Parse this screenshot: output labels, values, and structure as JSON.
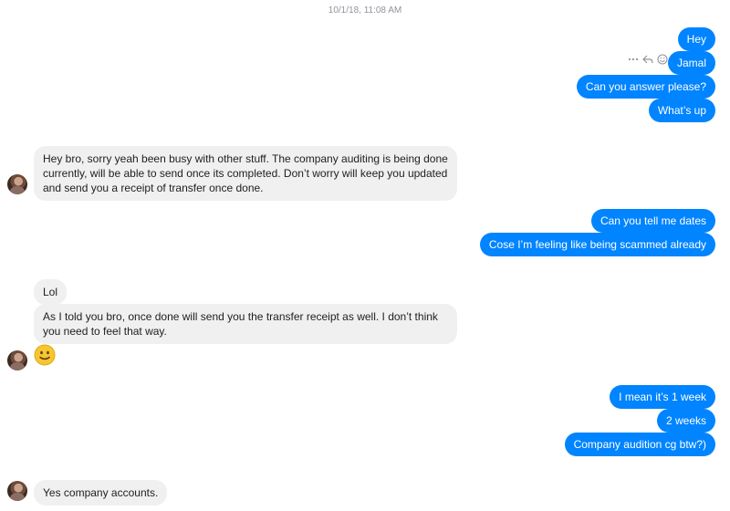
{
  "conversation": {
    "timestamp": "10/1/18, 11:08 AM",
    "outgoing_group_1": [
      "Hey",
      "Jamal",
      "Can you answer please?",
      "What’s up"
    ],
    "incoming_1": "Hey bro, sorry yeah been busy with other stuff. The company auditing is being done currently, will be able to send once its completed. Don’t worry will keep you updated and send you a receipt of transfer once done.",
    "outgoing_group_2": [
      "Can you tell me dates",
      "Cose I’m feeling like being scammed already"
    ],
    "incoming_2": [
      "Lol",
      "As I told you bro, once done will send you the transfer receipt as well. I don’t think you need to feel that way."
    ],
    "incoming_emoji": "slightly-smiling-face",
    "outgoing_group_3": [
      "I mean it’s 1 week",
      "2 weeks",
      "Company audition cg btw?)"
    ],
    "incoming_3": "Yes company accounts."
  },
  "colors": {
    "outgoing_bubble": "#0084ff",
    "incoming_bubble": "#f1f0f0",
    "timestamp": "#90949c"
  },
  "icons": {
    "more": "more-icon",
    "reply": "reply-icon",
    "reaction": "reaction-icon"
  }
}
